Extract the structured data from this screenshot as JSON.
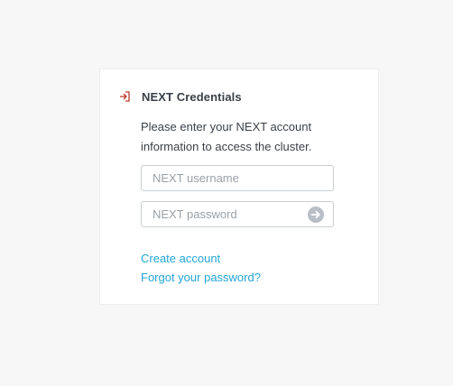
{
  "login": {
    "title": "NEXT Credentials",
    "description": "Please enter your NEXT account information to access the cluster.",
    "username_placeholder": "NEXT username",
    "username_value": "",
    "password_placeholder": "NEXT password",
    "password_value": "",
    "create_account_label": "Create account",
    "forgot_password_label": "Forgot your password?"
  },
  "icons": {
    "header": "sign-in-icon",
    "submit": "arrow-right-circle-icon"
  },
  "colors": {
    "background": "#f7f7f8",
    "card": "#ffffff",
    "text": "#3a3f47",
    "accent_icon": "#c0392b",
    "link": "#22a5d6",
    "placeholder": "#9aa0a8",
    "field_border": "#c9cdd3",
    "submit_button": "#b9bec6"
  }
}
